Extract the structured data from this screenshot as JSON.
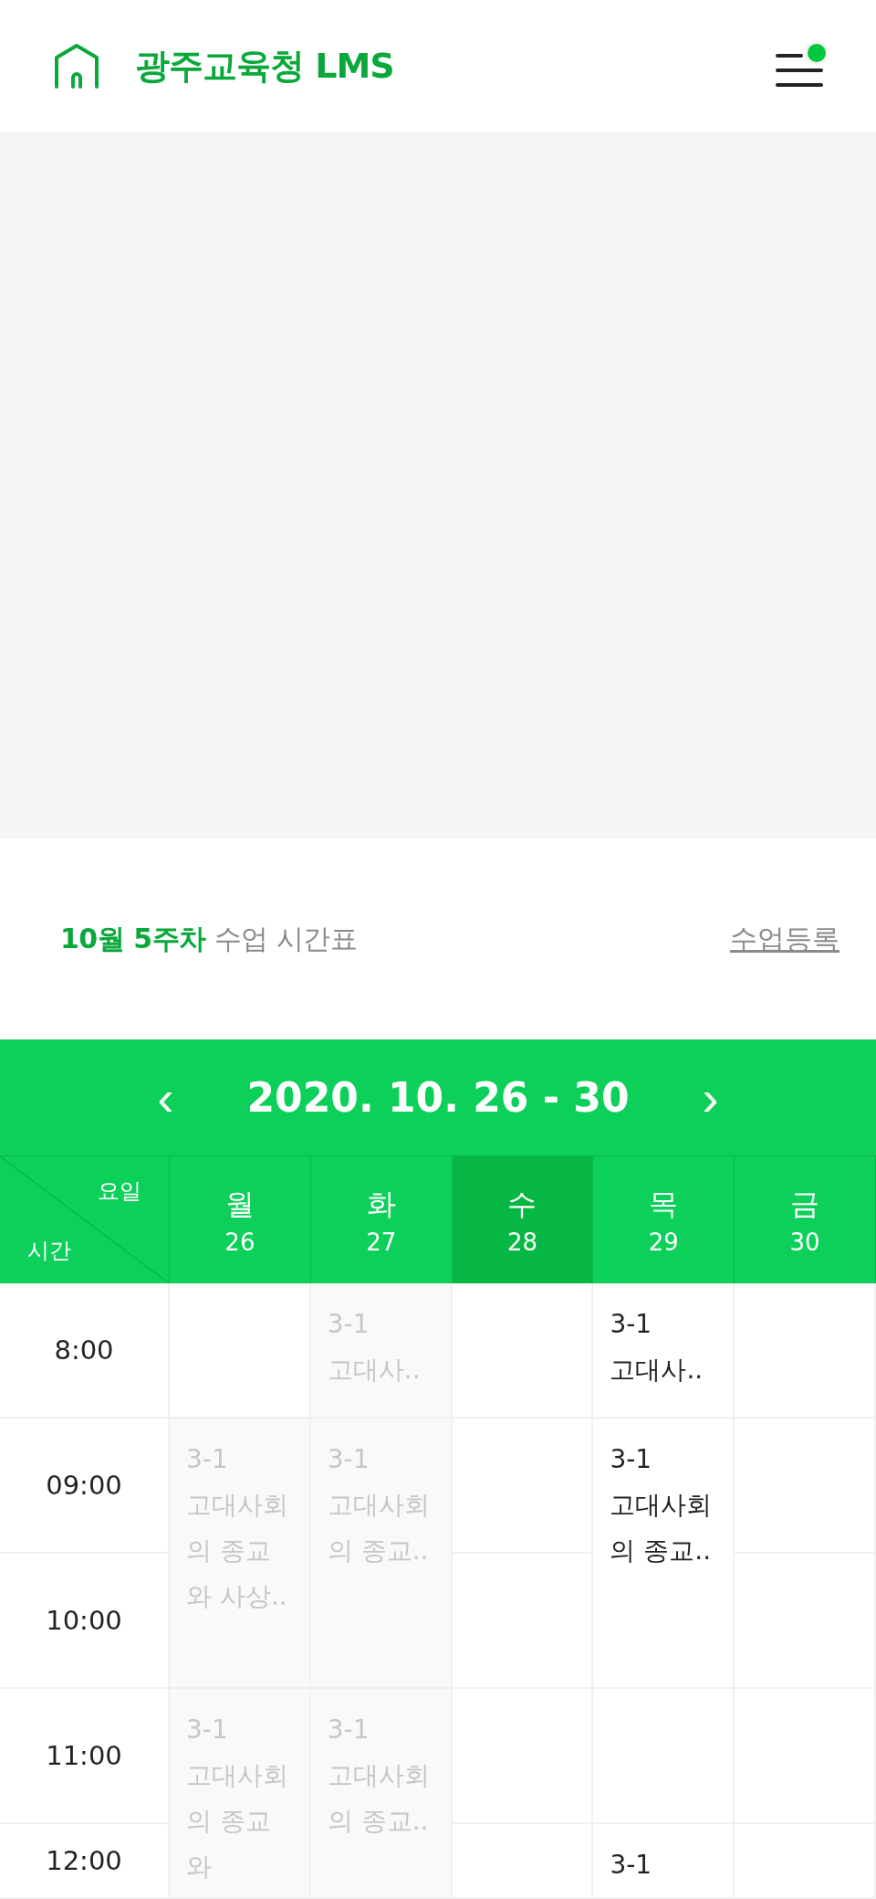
{
  "header": {
    "title": "광주교육청 LMS",
    "menu_badge": true
  },
  "banner": {
    "kind": "empty"
  },
  "section": {
    "title": "**10월 5주차** 수업 시간표",
    "link": "수업등록"
  },
  "week": {
    "prev": "‹",
    "label": "2020. 10. 26 - 30",
    "next": "›"
  },
  "corner": {
    "top": "요일",
    "bottom": "시간"
  },
  "days": [
    {
      "label": "월",
      "date": "26",
      "selected": false
    },
    {
      "label": "화",
      "date": "27",
      "selected": false
    },
    {
      "label": "수",
      "date": "28",
      "selected": true
    },
    {
      "label": "목",
      "date": "29",
      "selected": false
    },
    {
      "label": "금",
      "date": "30",
      "selected": false
    }
  ],
  "rows": [
    {
      "time": "8:00",
      "cells": [
        {
          "kind": "empty"
        },
        {
          "kind": "class",
          "code": "3-1",
          "title": "고대사..",
          "past": true
        },
        {
          "kind": "empty"
        },
        {
          "kind": "class",
          "code": "3-1",
          "title": "고대사..",
          "past": false
        },
        {
          "kind": "empty"
        }
      ]
    },
    {
      "time": "09:00",
      "cells": [
        {
          "kind": "class",
          "code": "3-1",
          "title": "고대사회의 종교와 사상..",
          "past": true
        },
        {
          "kind": "class",
          "code": "3-1",
          "title": "고대사회의 종교..",
          "past": true
        },
        {
          "kind": "empty"
        },
        {
          "kind": "class",
          "code": "3-1",
          "title": "고대사회의 종교..",
          "past": false
        },
        {
          "kind": "empty"
        }
      ]
    },
    {
      "time": "10:00",
      "cells": [
        {
          "kind": "continued"
        },
        {
          "kind": "continued"
        },
        {
          "kind": "empty"
        },
        {
          "kind": "continued"
        },
        {
          "kind": "empty"
        }
      ]
    },
    {
      "time": "11:00",
      "cells": [
        {
          "kind": "class",
          "code": "3-1",
          "title": "고대사회의 종교와",
          "past": true
        },
        {
          "kind": "class",
          "code": "3-1",
          "title": "고대사회의 종교..",
          "past": true
        },
        {
          "kind": "empty"
        },
        {
          "kind": "empty"
        },
        {
          "kind": "empty"
        }
      ]
    },
    {
      "time": "12:00",
      "cells": [
        {
          "kind": "continued"
        },
        {
          "kind": "continued"
        },
        {
          "kind": "empty"
        },
        {
          "kind": "class",
          "code": "3-1",
          "past": false
        },
        {
          "kind": "empty"
        }
      ]
    }
  ]
}
